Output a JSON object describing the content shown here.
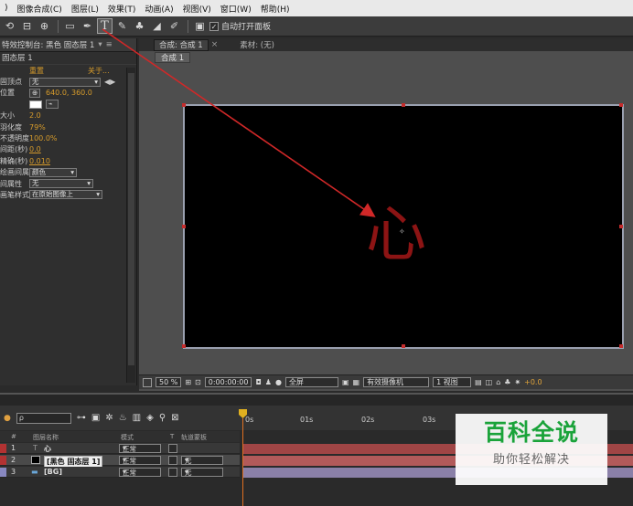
{
  "menu": [
    "图像合成(C)",
    "图层(L)",
    "效果(T)",
    "动画(A)",
    "视图(V)",
    "窗口(W)",
    "帮助(H)"
  ],
  "menu_leading": ")",
  "toolbar": {
    "auto_open_panel_label": "自动打开面板",
    "auto_open_checked": "✓"
  },
  "effects_panel": {
    "tab_label": "特效控制台: 黑色 固态层 1",
    "layer_label": "固态层 1",
    "reset_label": "重置",
    "about_label": "关于...",
    "rows": [
      {
        "label": "固顶点",
        "value": "无",
        "kind": "dropdown"
      },
      {
        "label": "位置",
        "value": "640.0, 360.0",
        "kind": "position"
      },
      {
        "label": "",
        "value": "",
        "kind": "color"
      },
      {
        "label": "大小",
        "value": "2.0",
        "kind": "value"
      },
      {
        "label": "羽化度",
        "value": "79%",
        "kind": "value"
      },
      {
        "label": "不透明度",
        "value": "100.0%",
        "kind": "value"
      },
      {
        "label": "间距(秒)",
        "value": "0.0",
        "kind": "value"
      },
      {
        "label": "精确(秒)",
        "value": "0.010",
        "kind": "value"
      },
      {
        "label": "绘画间属性",
        "value": "颜色",
        "kind": "dropdown"
      },
      {
        "label": "间属性",
        "value": "无",
        "kind": "dropdown"
      },
      {
        "label": "画笔样式",
        "value": "在原始图像上",
        "kind": "dropdown"
      }
    ]
  },
  "composition": {
    "tab_label": "合成: 合成 1",
    "footage_tab_label": "素材: (无)",
    "subtab_label": "合成 1",
    "canvas_character": "心",
    "footer": {
      "zoom": "50 %",
      "timecode": "0:00:00:00",
      "resolution": "全屏",
      "camera": "有效摄像机",
      "views": "1 视图",
      "exposure": "+0.0"
    }
  },
  "timeline": {
    "search_placeholder": "ρ",
    "ruler_labels": [
      "0s",
      "01s",
      "02s",
      "03s"
    ],
    "col_headers": [
      "#",
      "图层名称",
      "模式",
      "T",
      "轨道蒙板"
    ],
    "layers": [
      {
        "num": "1",
        "name": "心",
        "mode": "正常",
        "matte": "",
        "color": "#b23232",
        "bar": "#a04545"
      },
      {
        "num": "2",
        "name": "[黑色 固态层 1]",
        "mode": "正常",
        "matte": "无",
        "color": "#b23232",
        "bar": "#b25a5a"
      },
      {
        "num": "3",
        "name": "[BG]",
        "mode": "正常",
        "matte": "无",
        "color": "#8888c0",
        "bar": "#8a80a8"
      }
    ]
  },
  "watermark": {
    "title": "百科全说",
    "subtitle": "助你轻松解决"
  },
  "colors": {
    "accent_value": "#d69b2b",
    "arrow": "#d02828",
    "canvas_text": "#8c1414"
  }
}
